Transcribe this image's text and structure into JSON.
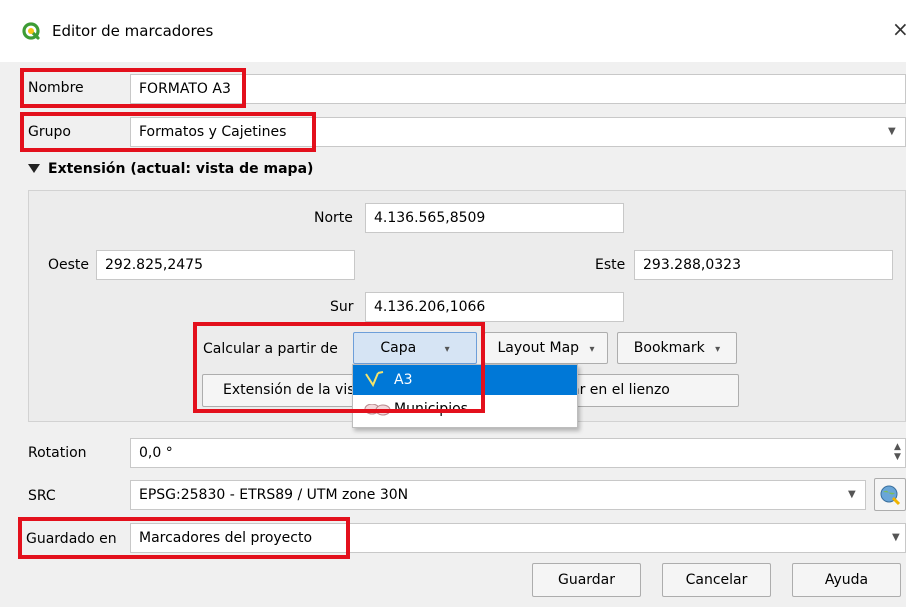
{
  "window": {
    "title": "Editor de marcadores",
    "close_glyph": "×"
  },
  "fields": {
    "nombre_label": "Nombre",
    "nombre_value": "FORMATO A3",
    "grupo_label": "Grupo",
    "grupo_value": "Formatos y Cajetines"
  },
  "extent": {
    "header": "Extensión (actual: vista de mapa)",
    "norte_label": "Norte",
    "norte_value": "4.136.565,8509",
    "oeste_label": "Oeste",
    "oeste_value": "292.825,2475",
    "este_label": "Este",
    "este_value": "293.288,0323",
    "sur_label": "Sur",
    "sur_value": "4.136.206,1066",
    "calc_label": "Calcular a partir de",
    "capa_button": "Capa",
    "layout_map_button": "Layout Map",
    "bookmark_button": "Bookmark",
    "extent_view_button": "Extensión de la vis",
    "canvas_button": "ar en el lienzo"
  },
  "popup": {
    "items": [
      {
        "label": "A3",
        "icon": "vector-line-layer-icon",
        "selected": true
      },
      {
        "label": "Municipios",
        "icon": "vector-polygon-layer-icon",
        "selected": false
      }
    ]
  },
  "rotation": {
    "label": "Rotation",
    "value": "0,0 °"
  },
  "src": {
    "label": "SRC",
    "value": "EPSG:25830 - ETRS89 / UTM zone 30N",
    "icon": "globe-crs-icon"
  },
  "saved": {
    "label": "Guardado en",
    "value": "Marcadores del proyecto"
  },
  "buttons": {
    "save": "Guardar",
    "cancel": "Cancelar",
    "help": "Ayuda"
  },
  "colors": {
    "highlight_red": "#e3101c",
    "selection_blue": "#0078d7",
    "qgis_green": "#3d9c35"
  }
}
